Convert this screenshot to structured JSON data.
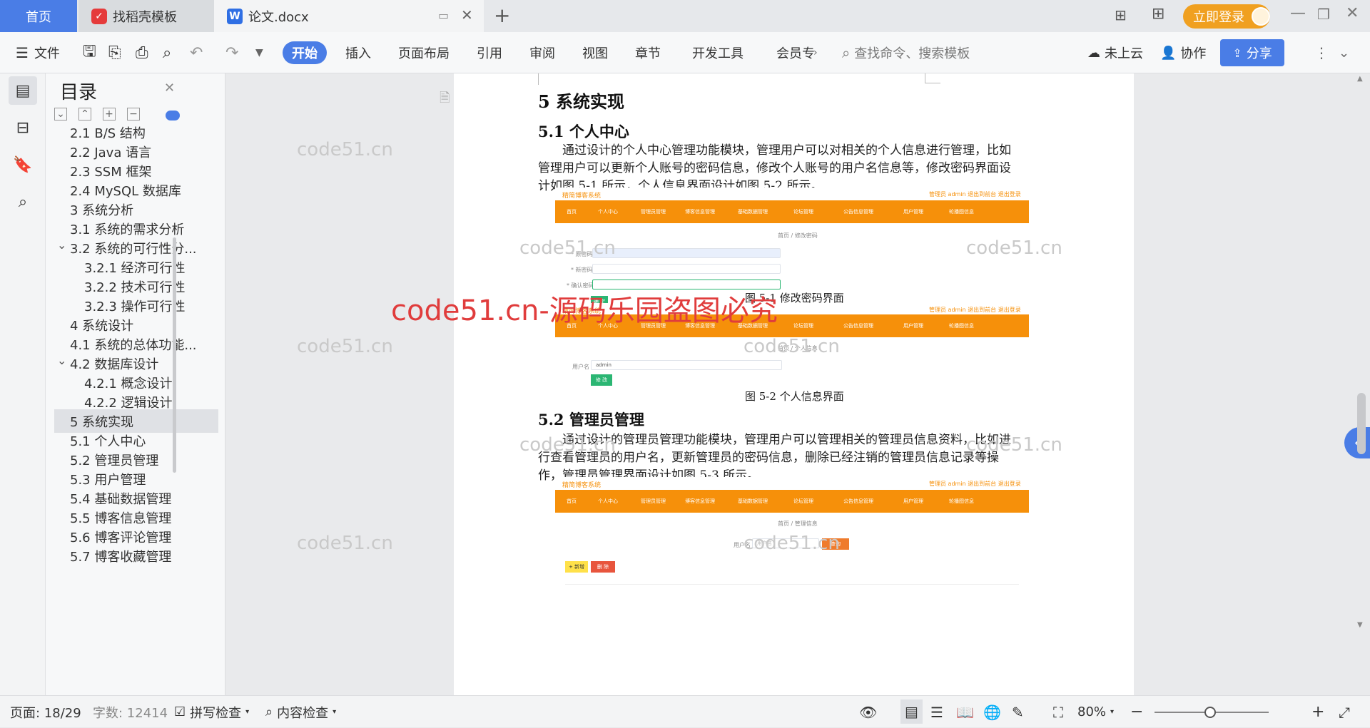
{
  "tabs": {
    "home": "首页",
    "template": "找稻壳模板",
    "doc": "论文.docx"
  },
  "titlebar": {
    "login_label": "立即登录"
  },
  "toolbar": {
    "file": "文件",
    "menus": [
      "开始",
      "插入",
      "页面布局",
      "引用",
      "审阅",
      "视图",
      "章节",
      "开发工具",
      "会员专"
    ],
    "search_placeholder": "查找命令、搜索模板",
    "cloud": "未上云",
    "collab": "协作",
    "share": "分享"
  },
  "toc": {
    "title": "目录",
    "items": [
      {
        "label": "2.1 B/S 结构",
        "level": 2,
        "selected": false,
        "expand": ""
      },
      {
        "label": "2.2 Java 语言",
        "level": 2,
        "selected": false,
        "expand": ""
      },
      {
        "label": "2.3 SSM 框架",
        "level": 2,
        "selected": false,
        "expand": ""
      },
      {
        "label": "2.4 MySQL 数据库",
        "level": 2,
        "selected": false,
        "expand": ""
      },
      {
        "label": "3 系统分析",
        "level": 2,
        "selected": false,
        "expand": ""
      },
      {
        "label": "3.1 系统的需求分析",
        "level": 2,
        "selected": false,
        "expand": ""
      },
      {
        "label": "3.2 系统的可行性分...",
        "level": 2,
        "selected": false,
        "expand": "v"
      },
      {
        "label": "3.2.1 经济可行性",
        "level": 3,
        "selected": false,
        "expand": ""
      },
      {
        "label": "3.2.2 技术可行性",
        "level": 3,
        "selected": false,
        "expand": ""
      },
      {
        "label": "3.2.3 操作可行性",
        "level": 3,
        "selected": false,
        "expand": ""
      },
      {
        "label": "4 系统设计",
        "level": 2,
        "selected": false,
        "expand": ""
      },
      {
        "label": "4.1 系统的总体功能...",
        "level": 2,
        "selected": false,
        "expand": ""
      },
      {
        "label": "4.2 数据库设计",
        "level": 2,
        "selected": false,
        "expand": "v"
      },
      {
        "label": "4.2.1 概念设计",
        "level": 3,
        "selected": false,
        "expand": ""
      },
      {
        "label": "4.2.2 逻辑设计",
        "level": 3,
        "selected": false,
        "expand": ""
      },
      {
        "label": "5 系统实现",
        "level": 2,
        "selected": true,
        "expand": ""
      },
      {
        "label": "5.1 个人中心",
        "level": 2,
        "selected": false,
        "expand": ""
      },
      {
        "label": "5.2 管理员管理",
        "level": 2,
        "selected": false,
        "expand": ""
      },
      {
        "label": "5.3 用户管理",
        "level": 2,
        "selected": false,
        "expand": ""
      },
      {
        "label": "5.4 基础数据管理",
        "level": 2,
        "selected": false,
        "expand": ""
      },
      {
        "label": "5.5 博客信息管理",
        "level": 2,
        "selected": false,
        "expand": ""
      },
      {
        "label": "5.6 博客评论管理",
        "level": 2,
        "selected": false,
        "expand": ""
      },
      {
        "label": "5.7 博客收藏管理",
        "level": 2,
        "selected": false,
        "expand": ""
      }
    ]
  },
  "doc": {
    "h1": "5 系统实现",
    "h2_1": "5.1 个人中心",
    "p1": "通过设计的个人中心管理功能模块，管理用户可以对相关的个人信息进行管理，比如管理用户可以更新个人账号的密码信息，修改个人账号的用户名信息等，修改密码界面设计如图 5-1 所示，个人信息界面设计如图 5-2 所示。",
    "cap1": "图 5-1 修改密码界面",
    "cap2": "图 5-2 个人信息界面",
    "h2_2": "5.2 管理员管理",
    "p2": "通过设计的管理员管理功能模块，管理用户可以管理相关的管理员信息资料，比如进行查看管理员的用户名，更新管理员的密码信息，删除已经注销的管理员信息记录等操作，管理员管理界面设计如图 5-3 所示。"
  },
  "shot": {
    "brand": "精简博客系统",
    "top_right": "管理员 admin   退出到前台   退出登录",
    "nav": [
      "首页",
      "个人中心",
      "管理员管理",
      "博客信息管理",
      "基础数据管理",
      "论坛管理",
      "公告信息管理",
      "用户管理",
      "轮播图信息"
    ],
    "crumb1": "首页 / 修改密码",
    "crumb2": "首页 / 个人信息",
    "crumb3": "首页 / 管理信息",
    "pw_labels": [
      "* 原密码",
      "* 新密码",
      "* 确认密码"
    ],
    "confirm": "确 定",
    "username_label": "用户名",
    "username_value": "admin",
    "modify": "修 改",
    "search_label": "用户名",
    "search_ph": "用户名",
    "search_btn": "查询",
    "add": "+ 新增",
    "del": "删 除"
  },
  "watermarks": {
    "small": "code51.cn",
    "big": "code51.cn-源码乐园盗图必究"
  },
  "status": {
    "page": "页面: 18/29",
    "words": "字数: 12414",
    "spell": "拼写检查",
    "content": "内容检查",
    "zoom": "80%"
  }
}
